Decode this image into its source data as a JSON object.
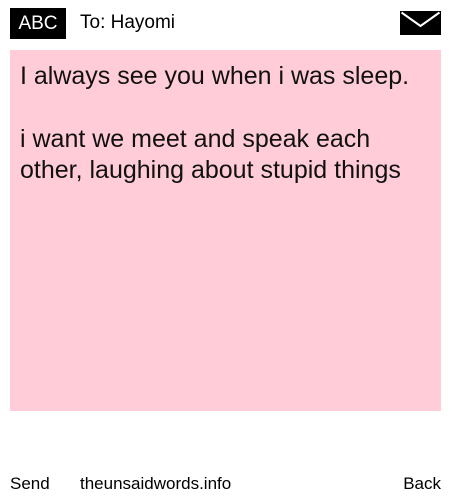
{
  "header": {
    "badge": "ABC",
    "recipient": "To: Hayomi",
    "envelope_icon": "envelope-icon"
  },
  "note": {
    "background": "#ffccd8",
    "paragraphs": [
      "I always see you when i was sleep.",
      "i want we meet and speak each other, laughing about stupid things"
    ]
  },
  "footer": {
    "send_label": "Send",
    "site_label": "theunsaidwords.info",
    "back_label": "Back"
  }
}
